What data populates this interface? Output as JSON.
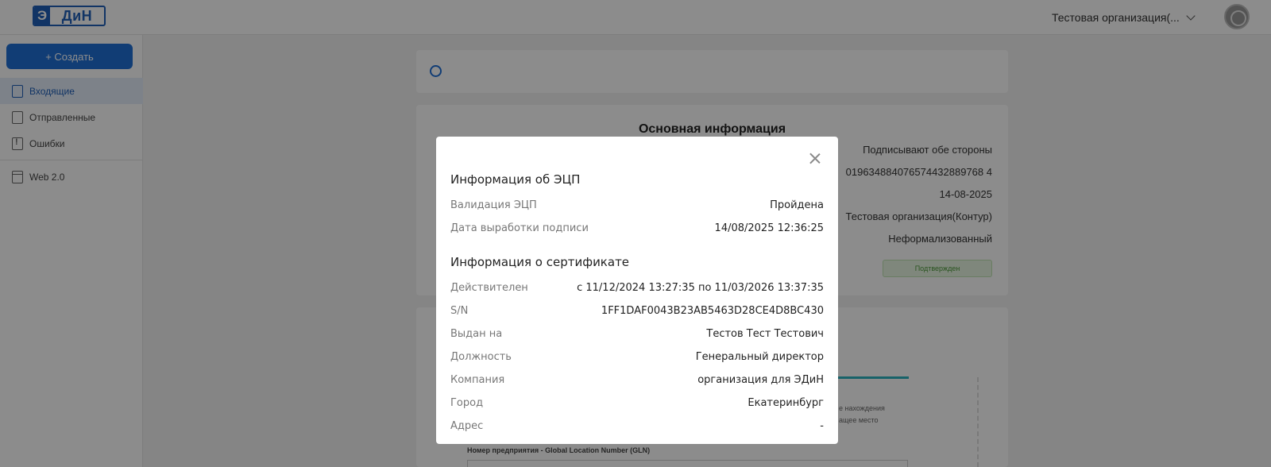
{
  "header": {
    "logo_letter": "Э",
    "logo_rest": "ДиН",
    "org_name": "Тестовая организация(...",
    "user_initials": ""
  },
  "sidebar": {
    "create_label": "+ Создать",
    "items": [
      {
        "label": "Входящие",
        "active": true
      },
      {
        "label": "Отправленные",
        "active": false
      },
      {
        "label": "Ошибки",
        "active": false
      },
      {
        "label": "Web 2.0",
        "active": false
      }
    ]
  },
  "background": {
    "main_info_title": "Основная информация",
    "rows": [
      "Подписывают обе стороны",
      "019634884076574432889768 4",
      "14-08-2025",
      "Тестовая организация(Контур)",
      "Неформализованный"
    ],
    "status_badge": "Подтвержден",
    "field_label": "Номер предприятия - Global Location Number (GLN)",
    "hint_1": "е нахождения",
    "hint_2": "ащее место"
  },
  "modal": {
    "signature_title": "Информация об ЭЦП",
    "signature_rows": [
      {
        "label": "Валидация ЭЦП",
        "value": "Пройдена"
      },
      {
        "label": "Дата выработки подписи",
        "value": "14/08/2025 12:36:25"
      }
    ],
    "certificate_title": "Информация о сертификате",
    "certificate_rows": [
      {
        "label": "Действителен",
        "value": "с 11/12/2024 13:27:35 по 11/03/2026 13:37:35"
      },
      {
        "label": "S/N",
        "value": "1FF1DAF0043B23AB5463D28CE4D8BC430"
      },
      {
        "label": "Выдан на",
        "value": "Тестов Тест Тестович"
      },
      {
        "label": "Должность",
        "value": "Генеральный директор"
      },
      {
        "label": "Компания",
        "value": "организация для ЭДиН"
      },
      {
        "label": "Город",
        "value": "Екатеринбург"
      },
      {
        "label": "Адрес",
        "value": "-"
      }
    ]
  },
  "colors": {
    "accent": "#1f6fd6",
    "overlay": "rgba(0,0,0,0.45)"
  }
}
